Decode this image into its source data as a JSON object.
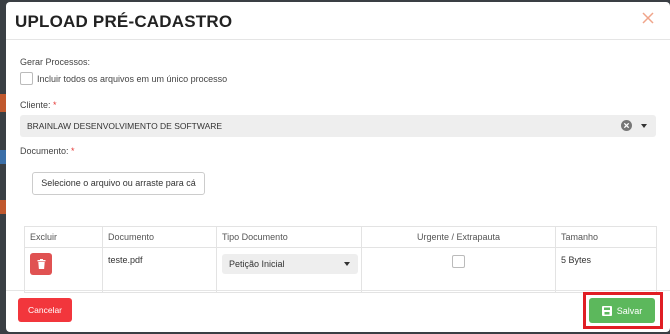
{
  "modal": {
    "title": "UPLOAD PRÉ-CADASTRO",
    "close_icon": "close-icon"
  },
  "form": {
    "gerar_label": "Gerar Processos:",
    "checkbox_label": "Incluir todos os arquivos em um único processo",
    "checkbox_checked": false,
    "cliente_label": "Cliente:",
    "cliente_value": "BRAINLAW DESENVOLVIMENTO DE SOFTWARE",
    "documento_label": "Documento:",
    "required_mark": "*",
    "upload_button": "Selecione o arquivo ou arraste para cá"
  },
  "table": {
    "headers": [
      "Excluir",
      "Documento",
      "Tipo Documento",
      "Urgente / Extrapauta",
      "Tamanho"
    ],
    "rows": [
      {
        "documento": "teste.pdf",
        "tipo": "Petição Inicial",
        "urgente": false,
        "tamanho": "5 Bytes"
      }
    ]
  },
  "footer": {
    "cancel_label": "Cancelar",
    "save_label": "Salvar"
  },
  "colors": {
    "cancel": "#f2363c",
    "save": "#5cb85c",
    "delete": "#e05252",
    "highlight": "#e01e24"
  }
}
